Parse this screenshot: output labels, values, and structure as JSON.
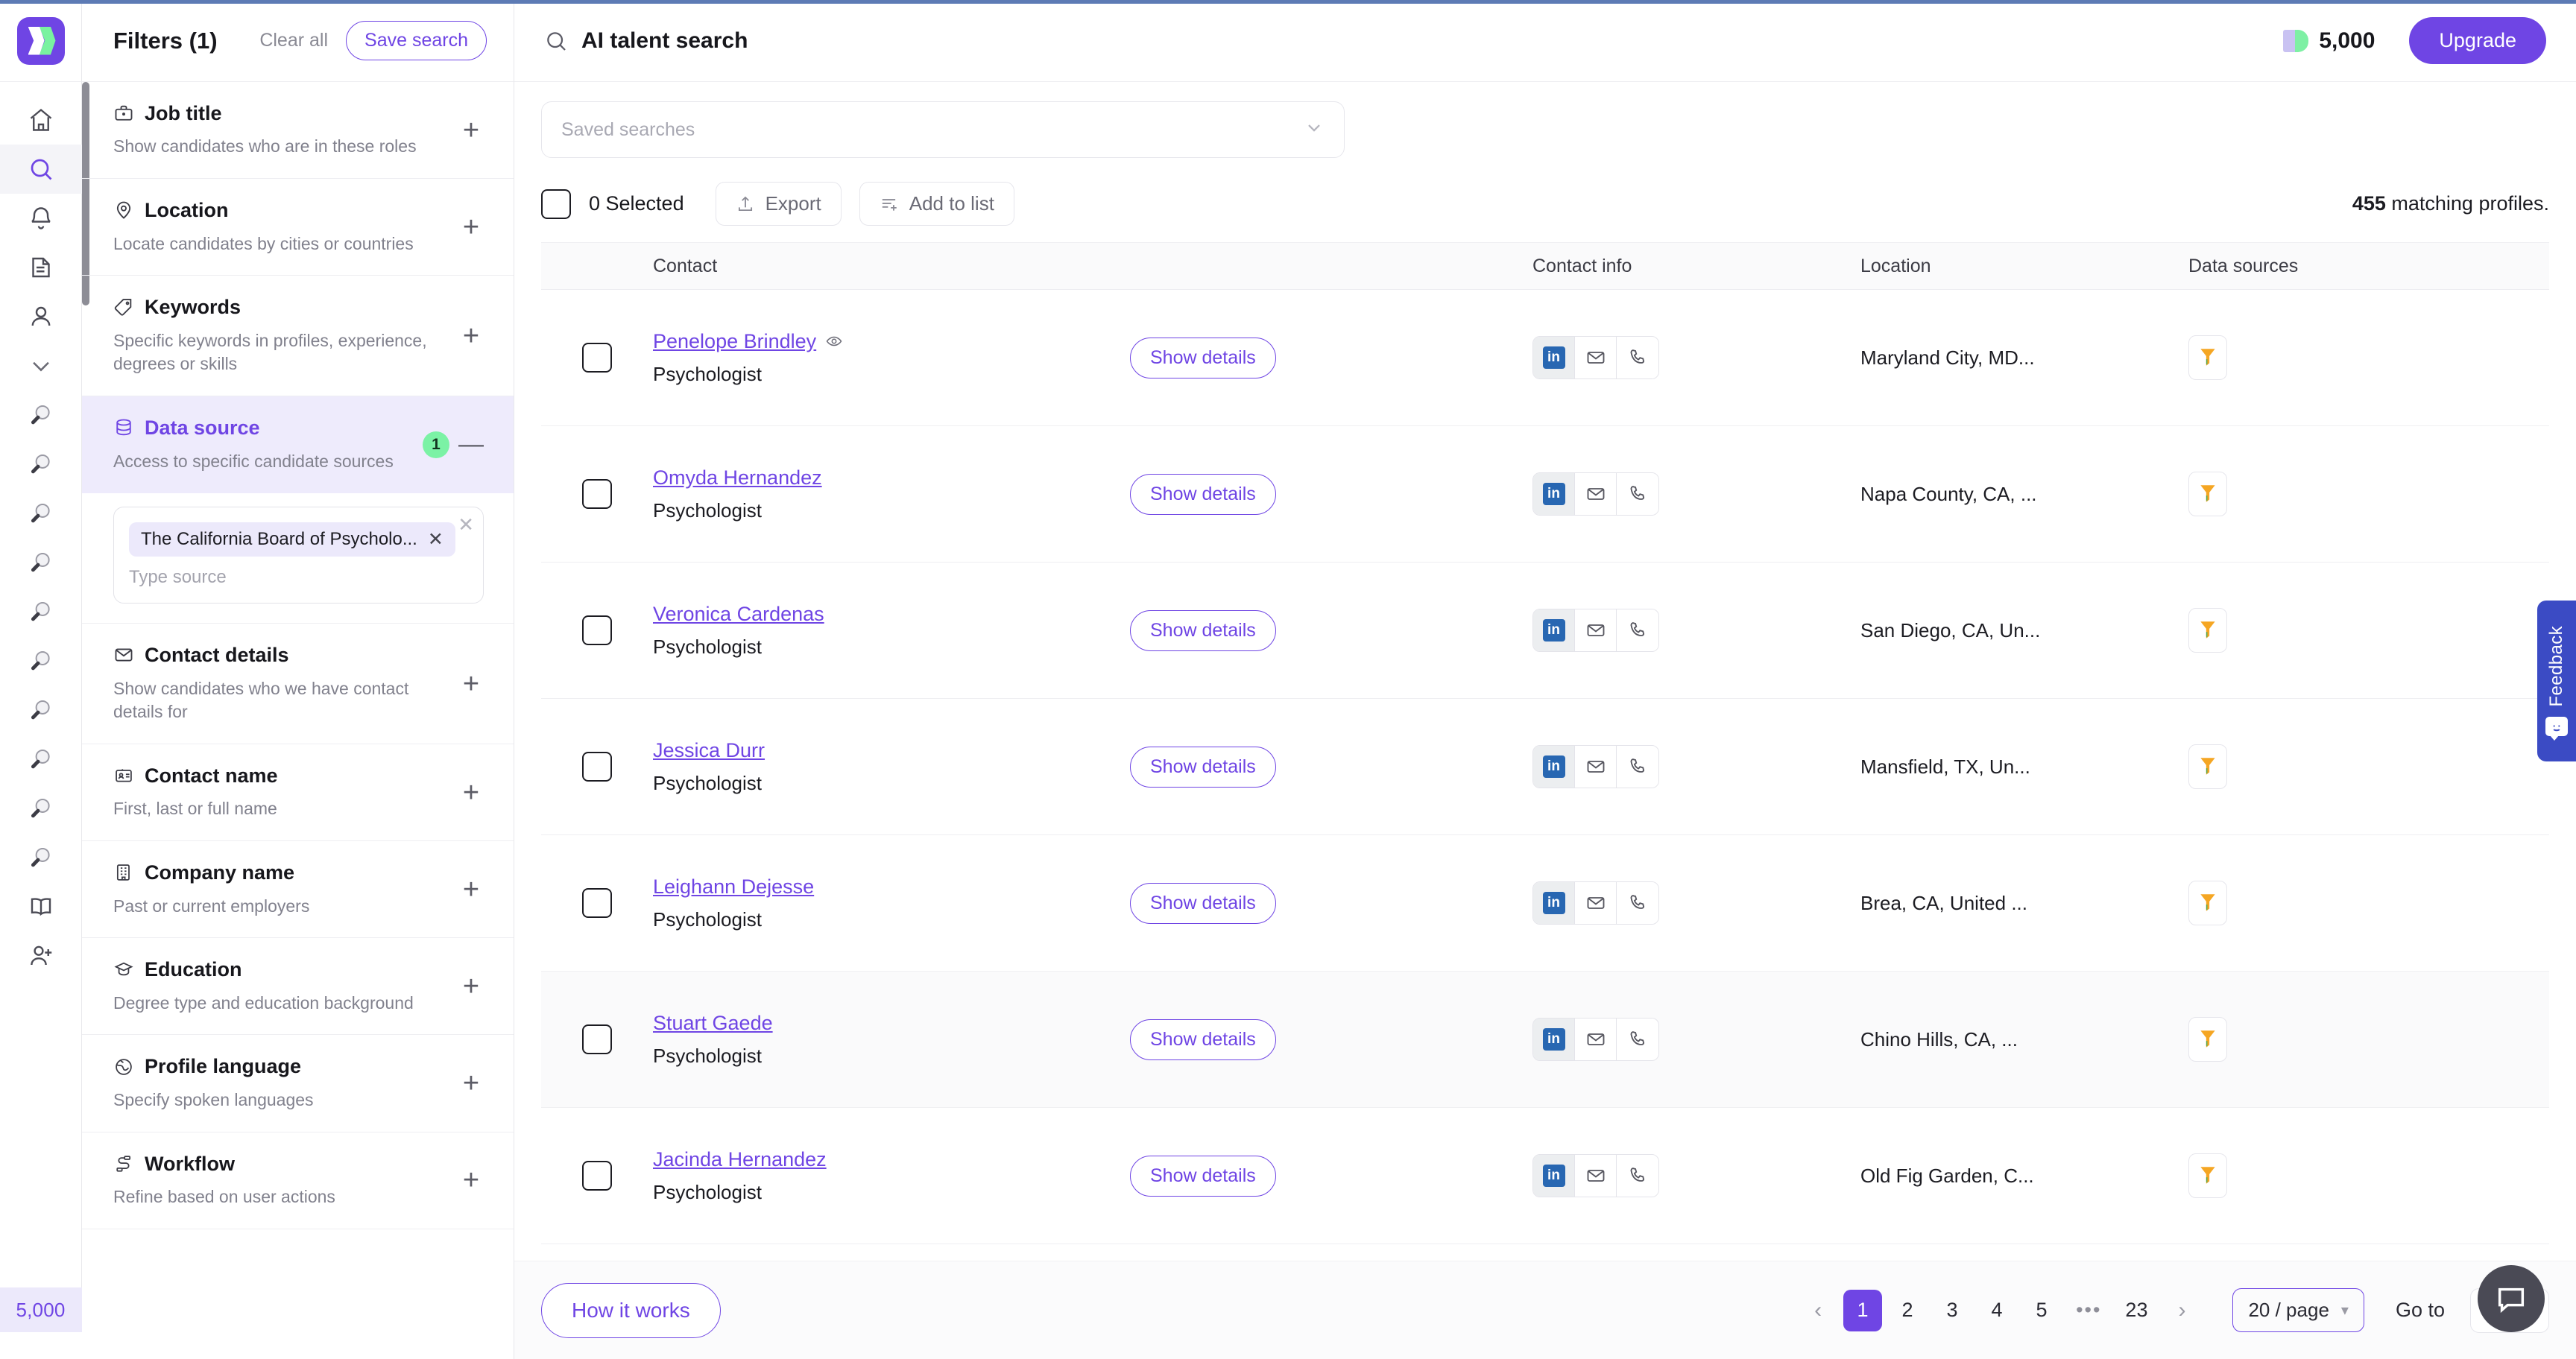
{
  "brand": {
    "accent": "#6f45e4",
    "accent_green": "#7bf2a5",
    "logo_name": "app-logo"
  },
  "rail": {
    "credits": "5,000",
    "items": [
      {
        "icon": "home-icon",
        "name": "home"
      },
      {
        "icon": "search-icon",
        "name": "search",
        "active": true
      },
      {
        "icon": "bell-icon",
        "name": "notifications"
      },
      {
        "icon": "document-icon",
        "name": "documents"
      },
      {
        "icon": "person-icon",
        "name": "contacts"
      },
      {
        "icon": "chevron-down-icon",
        "name": "expand"
      },
      {
        "icon": "magnifier-icon",
        "name": "saved-search-1"
      },
      {
        "icon": "magnifier-icon",
        "name": "saved-search-2"
      },
      {
        "icon": "magnifier-icon",
        "name": "saved-search-3"
      },
      {
        "icon": "magnifier-icon",
        "name": "saved-search-4"
      },
      {
        "icon": "magnifier-icon",
        "name": "saved-search-5"
      },
      {
        "icon": "magnifier-icon",
        "name": "saved-search-6"
      },
      {
        "icon": "magnifier-icon",
        "name": "saved-search-7"
      },
      {
        "icon": "magnifier-icon",
        "name": "saved-search-8"
      },
      {
        "icon": "magnifier-icon",
        "name": "saved-search-9"
      },
      {
        "icon": "magnifier-icon",
        "name": "saved-search-10"
      },
      {
        "icon": "book-icon",
        "name": "library"
      },
      {
        "icon": "add-person-icon",
        "name": "invite"
      }
    ]
  },
  "filters": {
    "title": "Filters (1)",
    "clear_all": "Clear all",
    "save_search": "Save search",
    "source_input": {
      "chip_label": "The California Board of Psycholo...",
      "placeholder": "Type source"
    },
    "items": [
      {
        "icon": "briefcase-icon",
        "label": "Job title",
        "desc": "Show candidates who are in these roles",
        "control": "plus"
      },
      {
        "icon": "map-pin-icon",
        "label": "Location",
        "desc": "Locate candidates by cities or countries",
        "control": "plus"
      },
      {
        "icon": "tag-icon",
        "label": "Keywords",
        "desc": "Specific keywords in profiles, experience, degrees or skills",
        "control": "plus"
      },
      {
        "icon": "database-icon",
        "label": "Data source",
        "desc": "Access to specific candidate sources",
        "control": "minus",
        "badge": "1",
        "active": true
      },
      {
        "icon": "envelope-icon",
        "label": "Contact details",
        "desc": "Show candidates who we have contact details for",
        "control": "plus"
      },
      {
        "icon": "id-card-icon",
        "label": "Contact name",
        "desc": "First, last or full name",
        "control": "plus"
      },
      {
        "icon": "building-icon",
        "label": "Company name",
        "desc": "Past or current employers",
        "control": "plus"
      },
      {
        "icon": "graduation-cap-icon",
        "label": "Education",
        "desc": "Degree type and education background",
        "control": "plus"
      },
      {
        "icon": "globe-icon",
        "label": "Profile language",
        "desc": "Specify spoken languages",
        "control": "plus"
      },
      {
        "icon": "workflow-icon",
        "label": "Workflow",
        "desc": "Refine based on user actions",
        "control": "plus"
      }
    ]
  },
  "topbar": {
    "title": "AI talent search",
    "credits": "5,000",
    "upgrade_label": "Upgrade"
  },
  "saved_searches": {
    "placeholder": "Saved searches"
  },
  "actionbar": {
    "selected_label": "0 Selected",
    "export_label": "Export",
    "add_to_list_label": "Add to list",
    "matching_count": "455",
    "matching_suffix": "matching profiles."
  },
  "table": {
    "headers": {
      "contact": "Contact",
      "contact_info": "Contact info",
      "location": "Location",
      "data_sources": "Data sources"
    },
    "show_details_label": "Show details",
    "rows": [
      {
        "name": "Penelope Brindley",
        "title": "Psychologist",
        "location": "Maryland City, MD...",
        "viewed": true
      },
      {
        "name": "Omyda Hernandez",
        "title": "Psychologist",
        "location": "Napa County, CA, ...",
        "viewed": false
      },
      {
        "name": "Veronica Cardenas",
        "title": "Psychologist",
        "location": "San Diego, CA, Un...",
        "viewed": false
      },
      {
        "name": "Jessica Durr",
        "title": "Psychologist",
        "location": "Mansfield, TX, Un...",
        "viewed": false
      },
      {
        "name": "Leighann Dejesse",
        "title": "Psychologist",
        "location": "Brea, CA, United ...",
        "viewed": false
      },
      {
        "name": "Stuart Gaede",
        "title": "Psychologist",
        "location": "Chino Hills, CA, ...",
        "viewed": false
      },
      {
        "name": "Jacinda Hernandez",
        "title": "Psychologist",
        "location": "Old Fig Garden, C...",
        "viewed": false
      }
    ]
  },
  "footer": {
    "how_it_works": "How it works",
    "pages": [
      "1",
      "2",
      "3",
      "4",
      "5",
      "•••",
      "23"
    ],
    "current_page": "1",
    "per_page": "20 / page",
    "goto_label": "Go to",
    "goto_value": "1"
  },
  "feedback": {
    "label": "Feedback"
  }
}
